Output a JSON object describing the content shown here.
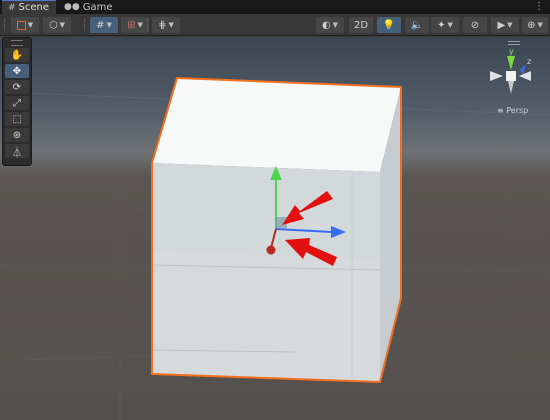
{
  "tabs": [
    {
      "label": "Scene",
      "icon": "hash-icon",
      "active": true
    },
    {
      "label": "Game",
      "icon": "gamepad-icon",
      "active": false
    }
  ],
  "toolbar": {
    "mode_2d_label": "2D",
    "view_options": [
      "draw-mode",
      "2D",
      "lighting",
      "audio",
      "effects",
      "hidden-objects",
      "camera",
      "gizmos"
    ]
  },
  "tools": [
    {
      "name": "hand",
      "icon": "hand-icon",
      "active": false
    },
    {
      "name": "move",
      "icon": "move-icon",
      "active": true
    },
    {
      "name": "rotate",
      "icon": "rotate-icon",
      "active": false
    },
    {
      "name": "scale",
      "icon": "scale-icon",
      "active": false
    },
    {
      "name": "rect",
      "icon": "rect-tool-icon",
      "active": false
    },
    {
      "name": "transform",
      "icon": "transform-icon",
      "active": false
    },
    {
      "name": "custom",
      "icon": "custom-tool-icon",
      "active": false
    }
  ],
  "gizmo": {
    "axis_y_label": "y",
    "axis_x_label": "x",
    "axis_z_label": "z",
    "projection_label": "≡ Persp"
  },
  "colors": {
    "selection_outline": "#f07020",
    "x_axis": "#3a6cf0",
    "y_axis": "#4fd64f",
    "z_axis": "#c0392b",
    "arrow_annotation": "#e31010",
    "active_button": "#46607c"
  }
}
